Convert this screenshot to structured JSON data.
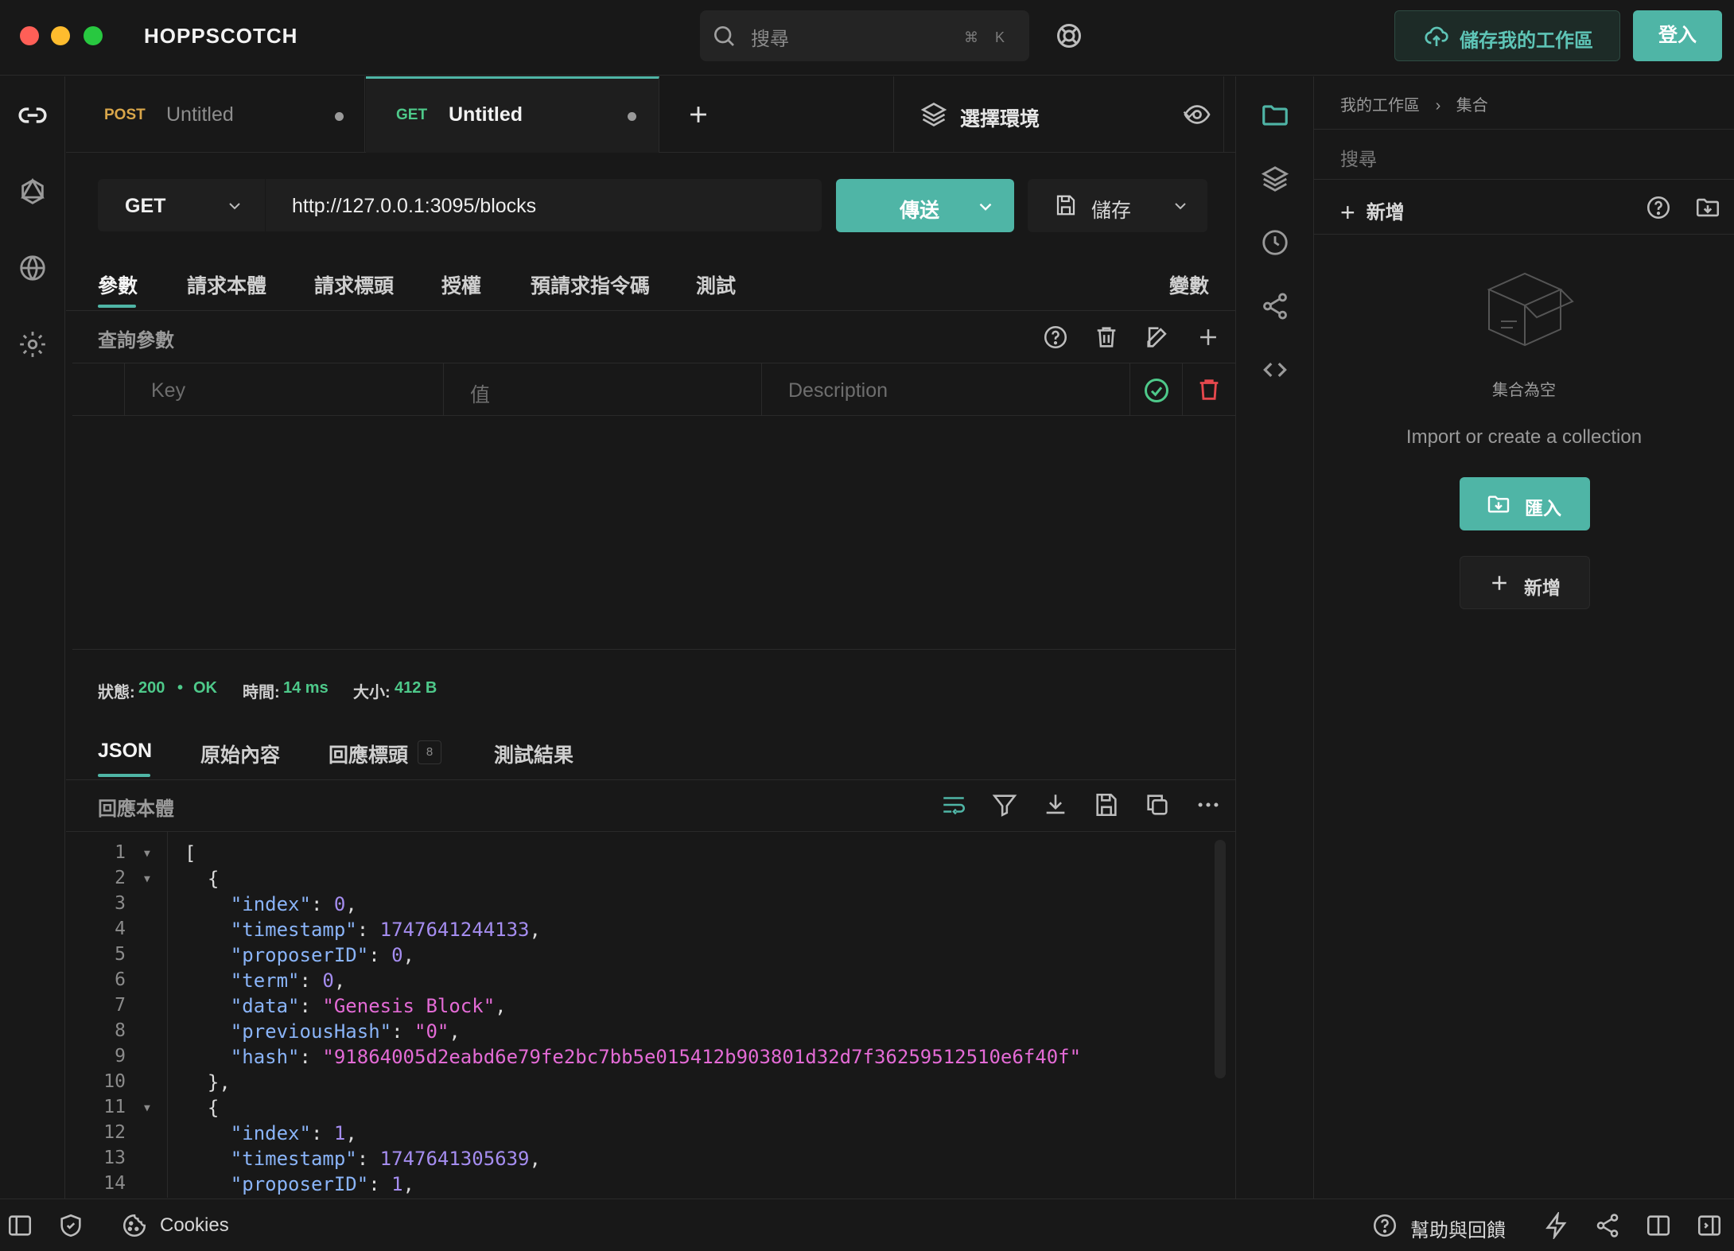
{
  "app": {
    "title": "HOPPSCOTCH"
  },
  "header": {
    "search_placeholder": "搜尋",
    "shortcut_cmd": "⌘",
    "shortcut_key": "K",
    "save_workspace_label": "儲存我的工作區",
    "login_label": "登入"
  },
  "tabs": [
    {
      "method": "POST",
      "name": "Untitled",
      "method_color": "#d9a64a"
    },
    {
      "method": "GET",
      "name": "Untitled",
      "method_color": "#4ec98a"
    }
  ],
  "environment": {
    "label": "選擇環境"
  },
  "request": {
    "method": "GET",
    "url": "http://127.0.0.1:3095/blocks",
    "send_label": "傳送",
    "save_label": "儲存",
    "tabs": [
      "參數",
      "請求本體",
      "請求標頭",
      "授權",
      "預請求指令碼",
      "測試"
    ],
    "variables_label": "變數",
    "query_params_label": "查詢參數",
    "key_placeholder": "Key",
    "value_placeholder": "值",
    "description_placeholder": "Description"
  },
  "response": {
    "status_label": "狀態:",
    "status_code": "200",
    "status_text": "OK",
    "time_label": "時間:",
    "time_value": "14 ms",
    "size_label": "大小:",
    "size_value": "412 B",
    "tabs": [
      "JSON",
      "原始內容",
      "回應標頭",
      "測試結果"
    ],
    "headers_count": "8",
    "body_label": "回應本體",
    "lines": [
      "1",
      "2",
      "3",
      "4",
      "5",
      "6",
      "7",
      "8",
      "9",
      "10",
      "11",
      "12",
      "13",
      "14"
    ]
  },
  "collections": {
    "breadcrumb_root": "我的工作區",
    "breadcrumb_current": "集合",
    "search_placeholder": "搜尋",
    "new_label": "新增",
    "empty_label": "集合為空",
    "empty_hint": "Import or create a collection",
    "import_label": "匯入",
    "add_label": "新增"
  },
  "footer": {
    "cookies_label": "Cookies",
    "help_label": "幫助與回饋"
  },
  "colors": {
    "accent": "#4fb5a6",
    "status_ok": "#4ec98a",
    "delete": "#e5484d"
  }
}
